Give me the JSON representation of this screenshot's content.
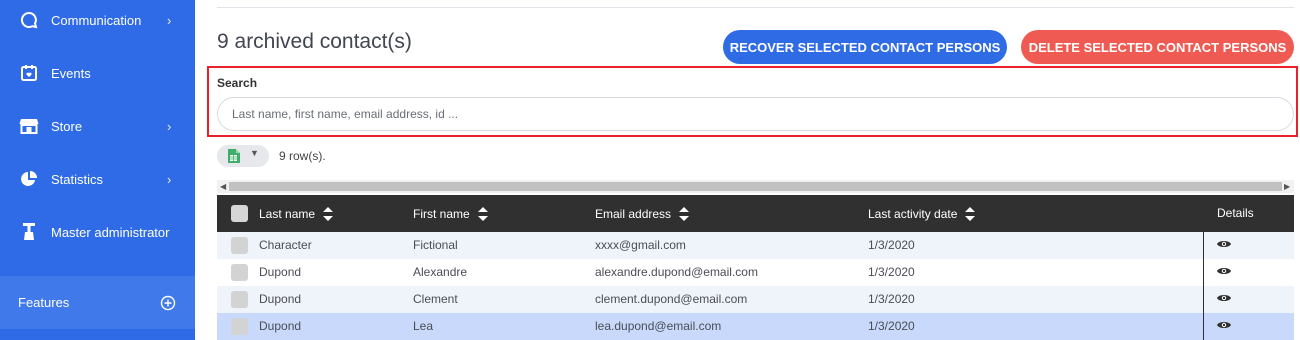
{
  "sidebar": {
    "items": [
      {
        "label": "Communication",
        "icon": "chat-icon",
        "has_submenu": true
      },
      {
        "label": "Events",
        "icon": "calendar-icon",
        "has_submenu": false
      },
      {
        "label": "Store",
        "icon": "store-icon",
        "has_submenu": true
      },
      {
        "label": "Statistics",
        "icon": "pie-chart-icon",
        "has_submenu": true
      },
      {
        "label": "Master administrator",
        "icon": "admin-icon",
        "has_submenu": false
      }
    ],
    "features_label": "Features",
    "colors": {
      "background": "#2f6be6",
      "features_background": "#3f79ea"
    }
  },
  "header": {
    "title": "9 archived contact(s)",
    "recover_label": "RECOVER SELECTED CONTACT PERSONS",
    "delete_label": "DELETE SELECTED CONTACT PERSONS",
    "colors": {
      "recover": "#2e6be4",
      "delete": "#ef5b52"
    }
  },
  "search": {
    "label": "Search",
    "placeholder": "Last name, first name, email address, id ...",
    "value": ""
  },
  "toolbar": {
    "export_icon": "spreadsheet-icon",
    "row_count": "9 row(s)."
  },
  "table": {
    "columns": [
      "Last name",
      "First name",
      "Email address",
      "Last activity date"
    ],
    "details_header": "Details",
    "rows": [
      {
        "last_name": "Character",
        "first_name": "Fictional",
        "email": "xxxx@gmail.com",
        "last_activity": "1/3/2020",
        "selected": false
      },
      {
        "last_name": "Dupond",
        "first_name": "Alexandre",
        "email": "alexandre.dupond@email.com",
        "last_activity": "1/3/2020",
        "selected": false
      },
      {
        "last_name": "Dupond",
        "first_name": "Clement",
        "email": "clement.dupond@email.com",
        "last_activity": "1/3/2020",
        "selected": false
      },
      {
        "last_name": "Dupond",
        "first_name": "Lea",
        "email": "lea.dupond@email.com",
        "last_activity": "1/3/2020",
        "selected": false
      }
    ],
    "colors": {
      "header": "#303030",
      "row_alt": "#eff3fa",
      "row_hover": "#c9d9fb"
    }
  }
}
